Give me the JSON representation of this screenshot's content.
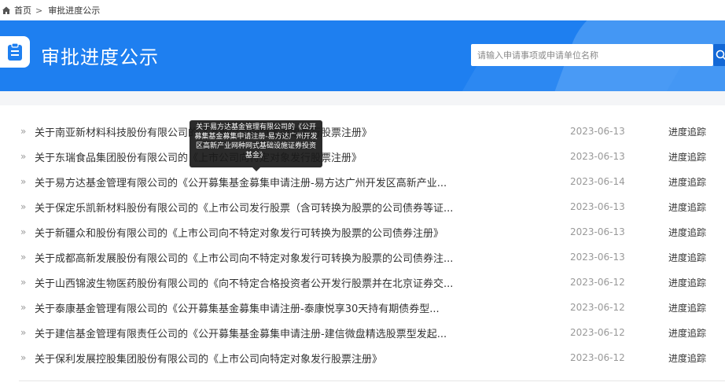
{
  "breadcrumb": {
    "home_label": "首页",
    "separator": ">",
    "current_label": "审批进度公示"
  },
  "banner": {
    "title": "审批进度公示",
    "bg_color": "#1e7ff0"
  },
  "search": {
    "placeholder": "请输入申请事项或申请单位名称",
    "value": ""
  },
  "tooltip": {
    "text": "关于易方达基金管理有限公司的《公开募集基金募集申请注册-易方达广州开发区高新产业网种网式基础设施证券投资基金》"
  },
  "list": {
    "action_label": "进度追踪",
    "bullet": "»",
    "items": [
      {
        "title": "关于南亚新材料科技股份有限公司的《上市公司向特定对象发行股票注册》",
        "date": "2023-06-13"
      },
      {
        "title": "关于东瑞食品集团股份有限公司的《上市公司向特定对象发行股票注册》",
        "date": "2023-06-13"
      },
      {
        "title": "关于易方达基金管理有限公司的《公开募集基金募集申请注册-易方达广州开发区高新产业...",
        "date": "2023-06-14"
      },
      {
        "title": "关于保定乐凯新材料股份有限公司的《上市公司发行股票（含可转换为股票的公司债券等证...",
        "date": "2023-06-13"
      },
      {
        "title": "关于新疆众和股份有限公司的《上市公司向不特定对象发行可转换为股票的公司债券注册》",
        "date": "2023-06-13"
      },
      {
        "title": "关于成都高新发展股份有限公司的《上市公司向不特定对象发行可转换为股票的公司债券注...",
        "date": "2023-06-13"
      },
      {
        "title": "关于山西锦波生物医药股份有限公司的《向不特定合格投资者公开发行股票并在北京证券交...",
        "date": "2023-06-12"
      },
      {
        "title": "关于泰康基金管理有限公司的《公开募集基金募集申请注册-泰康悦享30天持有期债券型...",
        "date": "2023-06-12"
      },
      {
        "title": "关于建信基金管理有限责任公司的《公开募集基金募集申请注册-建信微盘精选股票型发起...",
        "date": "2023-06-12"
      },
      {
        "title": "关于保利发展控股集团股份有限公司的《上市公司向特定对象发行股票注册》",
        "date": "2023-06-12"
      }
    ]
  }
}
